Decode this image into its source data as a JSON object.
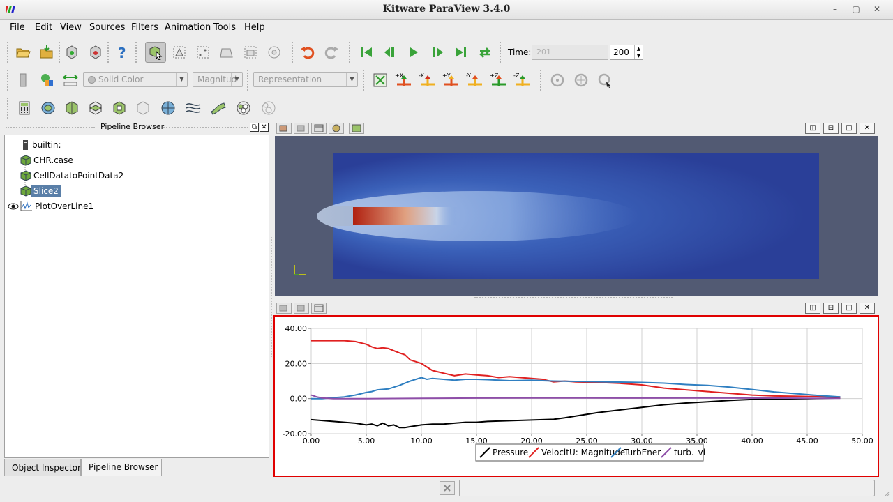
{
  "window": {
    "title": "Kitware ParaView 3.4.0"
  },
  "menu": [
    "File",
    "Edit",
    "View",
    "Sources",
    "Filters",
    "Animation",
    "Tools",
    "Help"
  ],
  "toolbar": {
    "color_by": "Solid Color",
    "component": "Magnitud",
    "representation": "Representation",
    "time_label": "Time:",
    "time_value": "201",
    "timestep": "200",
    "axis_buttons": [
      "+X",
      "-X",
      "+Y",
      "-Y",
      "+Z",
      "-Z"
    ]
  },
  "pipeline": {
    "title": "Pipeline Browser",
    "items": [
      {
        "label": "builtin:",
        "icon": "server-icon"
      },
      {
        "label": "CHR.case",
        "icon": "data-cube-icon"
      },
      {
        "label": "CellDatatoPointData2",
        "icon": "filter-cube-icon"
      },
      {
        "label": "Slice2",
        "icon": "filter-cube-icon",
        "selected": true
      },
      {
        "label": "PlotOverLine1",
        "icon": "line-plot-icon",
        "visible": true
      }
    ]
  },
  "tabs": [
    "Object Inspector",
    "Pipeline Browser"
  ],
  "active_tab": "Pipeline Browser",
  "colors": {
    "selection": "#5a7fa8",
    "view_background": "#525a73",
    "highlight_border": "#e00000"
  },
  "chart_data": {
    "type": "line",
    "xlim": [
      0,
      50
    ],
    "ylim": [
      -20,
      40
    ],
    "xticks": [
      "0.00",
      "5.00",
      "10.00",
      "15.00",
      "20.00",
      "25.00",
      "30.00",
      "35.00",
      "40.00",
      "45.00",
      "50.00"
    ],
    "yticks": [
      "40.00",
      "20.00",
      "0.00",
      "-20.00"
    ],
    "grid": true,
    "legend_position": "bottom",
    "series": [
      {
        "name": "Pressure",
        "color": "#000000",
        "points": [
          [
            0,
            -12
          ],
          [
            1,
            -12.5
          ],
          [
            2,
            -13
          ],
          [
            3,
            -13.5
          ],
          [
            4,
            -14
          ],
          [
            5,
            -15
          ],
          [
            5.5,
            -14.5
          ],
          [
            6,
            -15.5
          ],
          [
            6.5,
            -14
          ],
          [
            7,
            -15.5
          ],
          [
            7.5,
            -15
          ],
          [
            8,
            -16.5
          ],
          [
            8.5,
            -16.5
          ],
          [
            9,
            -16
          ],
          [
            10,
            -15
          ],
          [
            11,
            -14.5
          ],
          [
            12,
            -14.5
          ],
          [
            13,
            -14
          ],
          [
            14,
            -13.5
          ],
          [
            15,
            -13.5
          ],
          [
            16,
            -13
          ],
          [
            17,
            -12.8
          ],
          [
            18,
            -12.6
          ],
          [
            19,
            -12.4
          ],
          [
            20,
            -12.2
          ],
          [
            21,
            -12
          ],
          [
            22,
            -11.8
          ],
          [
            23,
            -11
          ],
          [
            24,
            -10
          ],
          [
            25,
            -9
          ],
          [
            26,
            -8
          ],
          [
            28,
            -6.5
          ],
          [
            30,
            -5
          ],
          [
            32,
            -3.5
          ],
          [
            34,
            -2.5
          ],
          [
            36,
            -1.8
          ],
          [
            38,
            -1
          ],
          [
            40,
            -0.5
          ],
          [
            42,
            -0.2
          ],
          [
            45,
            0
          ],
          [
            48,
            0.3
          ]
        ]
      },
      {
        "name": "VelocitU: Magnitude",
        "color": "#e02020",
        "points": [
          [
            0,
            33
          ],
          [
            1,
            33
          ],
          [
            2,
            33
          ],
          [
            3,
            33
          ],
          [
            4,
            32.5
          ],
          [
            5,
            31
          ],
          [
            5.5,
            29.5
          ],
          [
            6,
            28.5
          ],
          [
            6.5,
            29
          ],
          [
            7,
            28.5
          ],
          [
            8,
            26
          ],
          [
            8.5,
            25
          ],
          [
            9,
            22
          ],
          [
            10,
            20
          ],
          [
            10.5,
            18
          ],
          [
            11,
            16
          ],
          [
            12,
            14.5
          ],
          [
            13,
            13
          ],
          [
            14,
            14
          ],
          [
            15,
            13.5
          ],
          [
            16,
            13
          ],
          [
            17,
            12
          ],
          [
            18,
            12.5
          ],
          [
            19,
            12
          ],
          [
            20,
            11.5
          ],
          [
            21,
            11
          ],
          [
            22,
            9.5
          ],
          [
            23,
            10
          ],
          [
            24,
            9.5
          ],
          [
            26,
            9.2
          ],
          [
            28,
            8.7
          ],
          [
            30,
            7.8
          ],
          [
            32,
            6
          ],
          [
            34,
            5
          ],
          [
            36,
            4
          ],
          [
            38,
            3
          ],
          [
            40,
            2
          ],
          [
            42,
            1.5
          ],
          [
            45,
            1.2
          ],
          [
            48,
            1
          ]
        ]
      },
      {
        "name": "TurbEner",
        "color": "#2f7fc1",
        "points": [
          [
            0,
            0
          ],
          [
            1,
            0
          ],
          [
            2,
            0.5
          ],
          [
            3,
            1
          ],
          [
            4,
            2
          ],
          [
            5,
            3.5
          ],
          [
            5.5,
            4
          ],
          [
            6,
            5
          ],
          [
            7,
            5.5
          ],
          [
            8,
            7.5
          ],
          [
            9,
            10
          ],
          [
            9.5,
            11
          ],
          [
            10,
            12
          ],
          [
            10.5,
            11
          ],
          [
            11,
            11.5
          ],
          [
            12,
            11
          ],
          [
            13,
            10.5
          ],
          [
            14,
            11
          ],
          [
            15,
            11
          ],
          [
            16,
            10.8
          ],
          [
            17,
            10.5
          ],
          [
            18,
            10.2
          ],
          [
            19,
            10.3
          ],
          [
            20,
            10.5
          ],
          [
            21,
            10.2
          ],
          [
            22,
            10
          ],
          [
            24,
            9.8
          ],
          [
            26,
            9.6
          ],
          [
            28,
            9.4
          ],
          [
            30,
            9.2
          ],
          [
            32,
            8.8
          ],
          [
            34,
            8
          ],
          [
            36,
            7.5
          ],
          [
            38,
            6.5
          ],
          [
            40,
            5.2
          ],
          [
            42,
            3.8
          ],
          [
            44,
            2.8
          ],
          [
            46,
            1.8
          ],
          [
            48,
            1
          ]
        ]
      },
      {
        "name": "turb._vi",
        "color": "#8e4ea8",
        "points": [
          [
            0,
            2
          ],
          [
            0.5,
            1
          ],
          [
            1,
            0.4
          ],
          [
            2,
            0
          ],
          [
            5,
            0
          ],
          [
            10,
            0.2
          ],
          [
            15,
            0.3
          ],
          [
            20,
            0.4
          ],
          [
            25,
            0.4
          ],
          [
            30,
            0.3
          ],
          [
            35,
            0.4
          ],
          [
            40,
            0.3
          ],
          [
            45,
            0.2
          ],
          [
            48,
            0.2
          ]
        ]
      }
    ]
  }
}
